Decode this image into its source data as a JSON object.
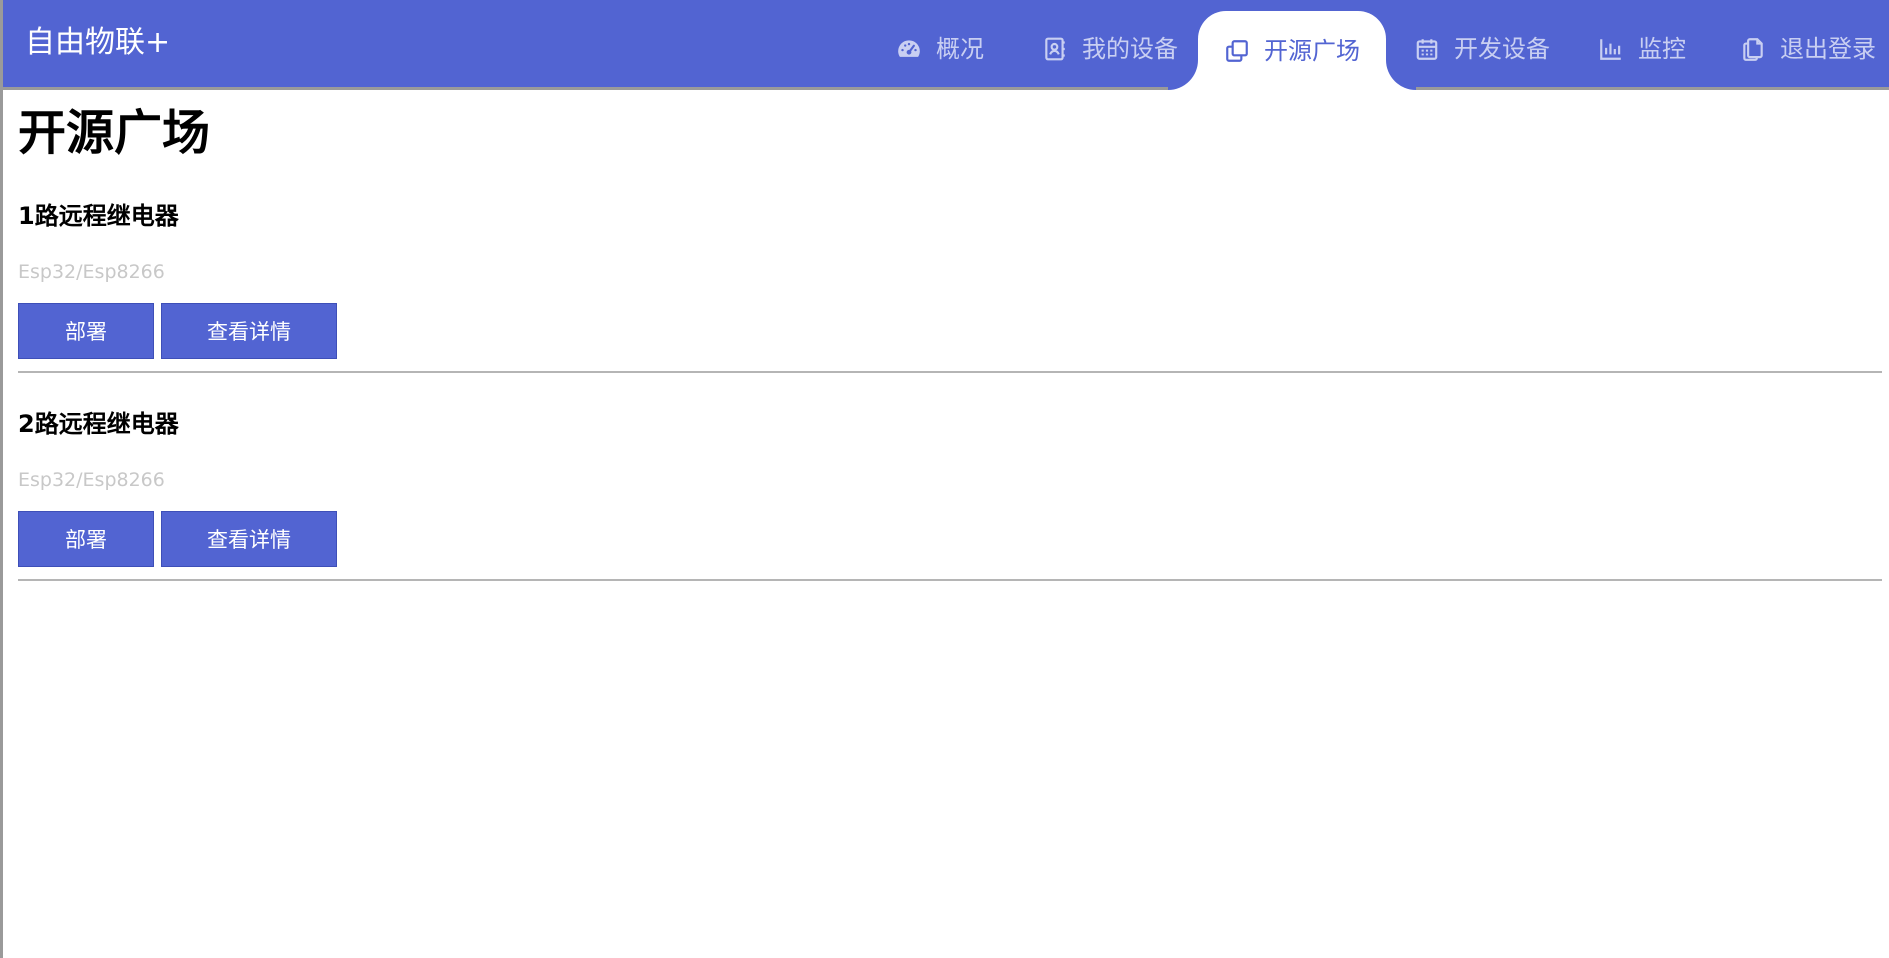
{
  "app": {
    "brand": "自由物联+"
  },
  "nav": {
    "items": [
      {
        "label": "概况",
        "icon": "dashboard-icon",
        "active": false
      },
      {
        "label": "我的设备",
        "icon": "contacts-icon",
        "active": false
      },
      {
        "label": "开源广场",
        "icon": "copy-icon",
        "active": true
      },
      {
        "label": "开发设备",
        "icon": "calendar-icon",
        "active": false
      },
      {
        "label": "监控",
        "icon": "bar-chart-icon",
        "active": false
      },
      {
        "label": "退出登录",
        "icon": "files-icon",
        "active": false
      }
    ]
  },
  "page": {
    "title": "开源广场"
  },
  "projects": [
    {
      "name": "1路远程继电器",
      "platform": "Esp32/Esp8266",
      "deploy_label": "部署",
      "detail_label": "查看详情"
    },
    {
      "name": "2路远程继电器",
      "platform": "Esp32/Esp8266",
      "deploy_label": "部署",
      "detail_label": "查看详情"
    }
  ],
  "colors": {
    "primary": "#5264d2",
    "nav_inactive_text": "#c9cff2",
    "muted_text": "#c8c8c8",
    "divider": "#b5b5b5"
  }
}
